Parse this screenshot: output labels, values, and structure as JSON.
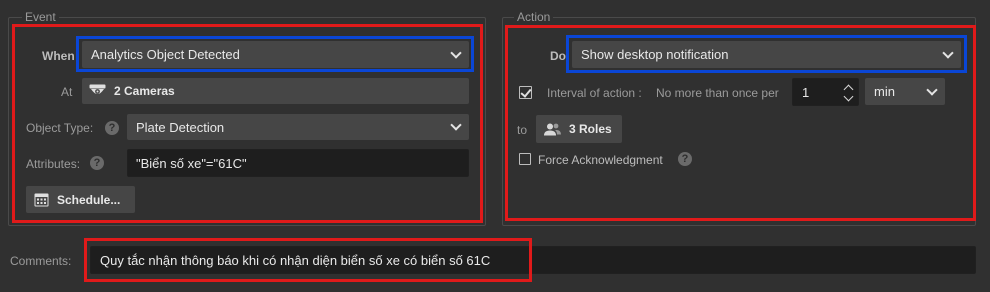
{
  "event": {
    "title": "Event",
    "when_label": "When",
    "when_value": "Analytics Object Detected",
    "at_label": "At",
    "at_value": "2 Cameras",
    "object_type_label": "Object Type:",
    "object_type_value": "Plate Detection",
    "attributes_label": "Attributes:",
    "attributes_value": "\"Biển số xe\"=\"61C\"",
    "schedule_label": "Schedule..."
  },
  "action": {
    "title": "Action",
    "do_label": "Do",
    "do_value": "Show desktop notification",
    "interval_label": "Interval of action :",
    "interval_hint": "No more than once per",
    "interval_value": "1",
    "interval_unit": "min",
    "interval_checked": true,
    "to_label": "to",
    "to_value": "3 Roles",
    "force_ack_label": "Force Acknowledgment",
    "force_ack_checked": false
  },
  "comments": {
    "label": "Comments:",
    "value": "Quy tắc nhận thông báo khi có nhận diện biển số xe có biển số 61C"
  },
  "colors": {
    "background": "#303030",
    "highlight_red": "#e01a1a",
    "highlight_blue": "#0a46d6"
  },
  "icons": {
    "at": "camera-icon",
    "schedule": "calendar-icon",
    "roles": "users-icon",
    "help": "help-icon"
  }
}
